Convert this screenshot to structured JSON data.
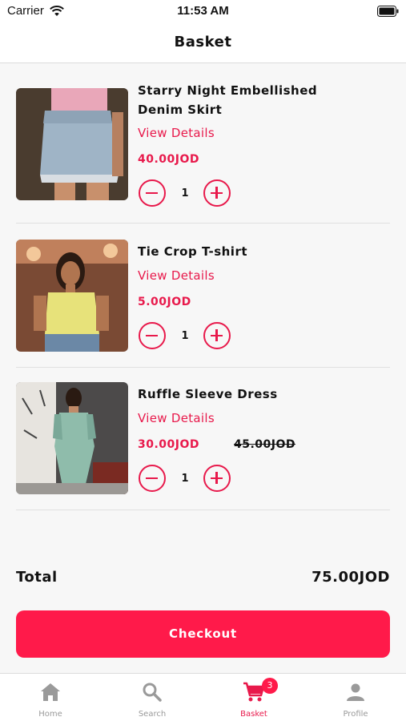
{
  "status_bar": {
    "carrier": "Carrier",
    "time": "11:53 AM"
  },
  "header": {
    "title": "Basket"
  },
  "items": [
    {
      "name_line1": "Starry Night Embellished",
      "name_line2": "Denim Skirt",
      "view_details": "View Details",
      "price": "40.00JOD",
      "old_price": "",
      "quantity": "1"
    },
    {
      "name_line1": "Tie Crop T-shirt",
      "name_line2": "",
      "view_details": "View Details",
      "price": "5.00JOD",
      "old_price": "",
      "quantity": "1"
    },
    {
      "name_line1": "Ruffle Sleeve Dress",
      "name_line2": "",
      "view_details": "View Details",
      "price": "30.00JOD",
      "old_price": "45.00JOD",
      "quantity": "1"
    }
  ],
  "summary": {
    "total_label": "Total",
    "total_value": "75.00JOD"
  },
  "checkout": {
    "label": "Checkout"
  },
  "tab_bar": {
    "tabs": [
      {
        "label": "Home",
        "icon": "home-icon"
      },
      {
        "label": "Search",
        "icon": "search-icon"
      },
      {
        "label": "Basket",
        "icon": "cart-icon",
        "badge": "3"
      },
      {
        "label": "Profile",
        "icon": "profile-icon"
      }
    ]
  },
  "colors": {
    "accent": "#e8194b",
    "button": "#ff1a4a",
    "inactive": "#999999"
  }
}
